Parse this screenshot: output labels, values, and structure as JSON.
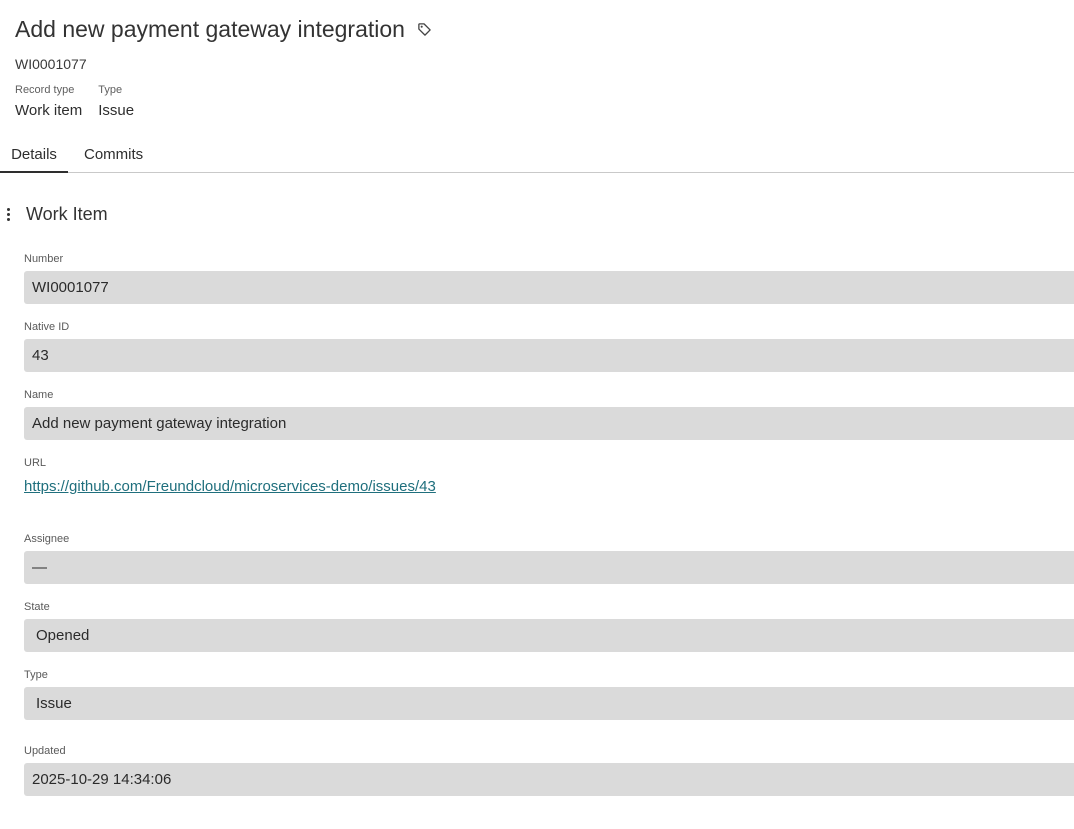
{
  "header": {
    "title": "Add new payment gateway integration",
    "tag_icon": "tag-icon",
    "number": "WI0001077",
    "meta": [
      {
        "label": "Record type",
        "value": "Work item"
      },
      {
        "label": "Type",
        "value": "Issue"
      }
    ]
  },
  "tabs": [
    {
      "label": "Details",
      "active": true
    },
    {
      "label": "Commits",
      "active": false
    }
  ],
  "section": {
    "title": "Work Item",
    "menu_icon": "more-vertical-icon"
  },
  "fields": {
    "number": {
      "label": "Number",
      "value": "WI0001077"
    },
    "native_id": {
      "label": "Native ID",
      "value": "43"
    },
    "name": {
      "label": "Name",
      "value": "Add new payment gateway integration"
    },
    "url": {
      "label": "URL",
      "value": "https://github.com/Freundcloud/microservices-demo/issues/43"
    },
    "assignee": {
      "label": "Assignee",
      "value": "—"
    },
    "state": {
      "label": "State",
      "value": "Opened"
    },
    "type": {
      "label": "Type",
      "value": "Issue"
    },
    "updated": {
      "label": "Updated",
      "value": "2025-10-29 14:34:06"
    }
  },
  "colors": {
    "field_background": "#dadada",
    "link": "#1f6f7d",
    "text": "#2e2e2e"
  }
}
